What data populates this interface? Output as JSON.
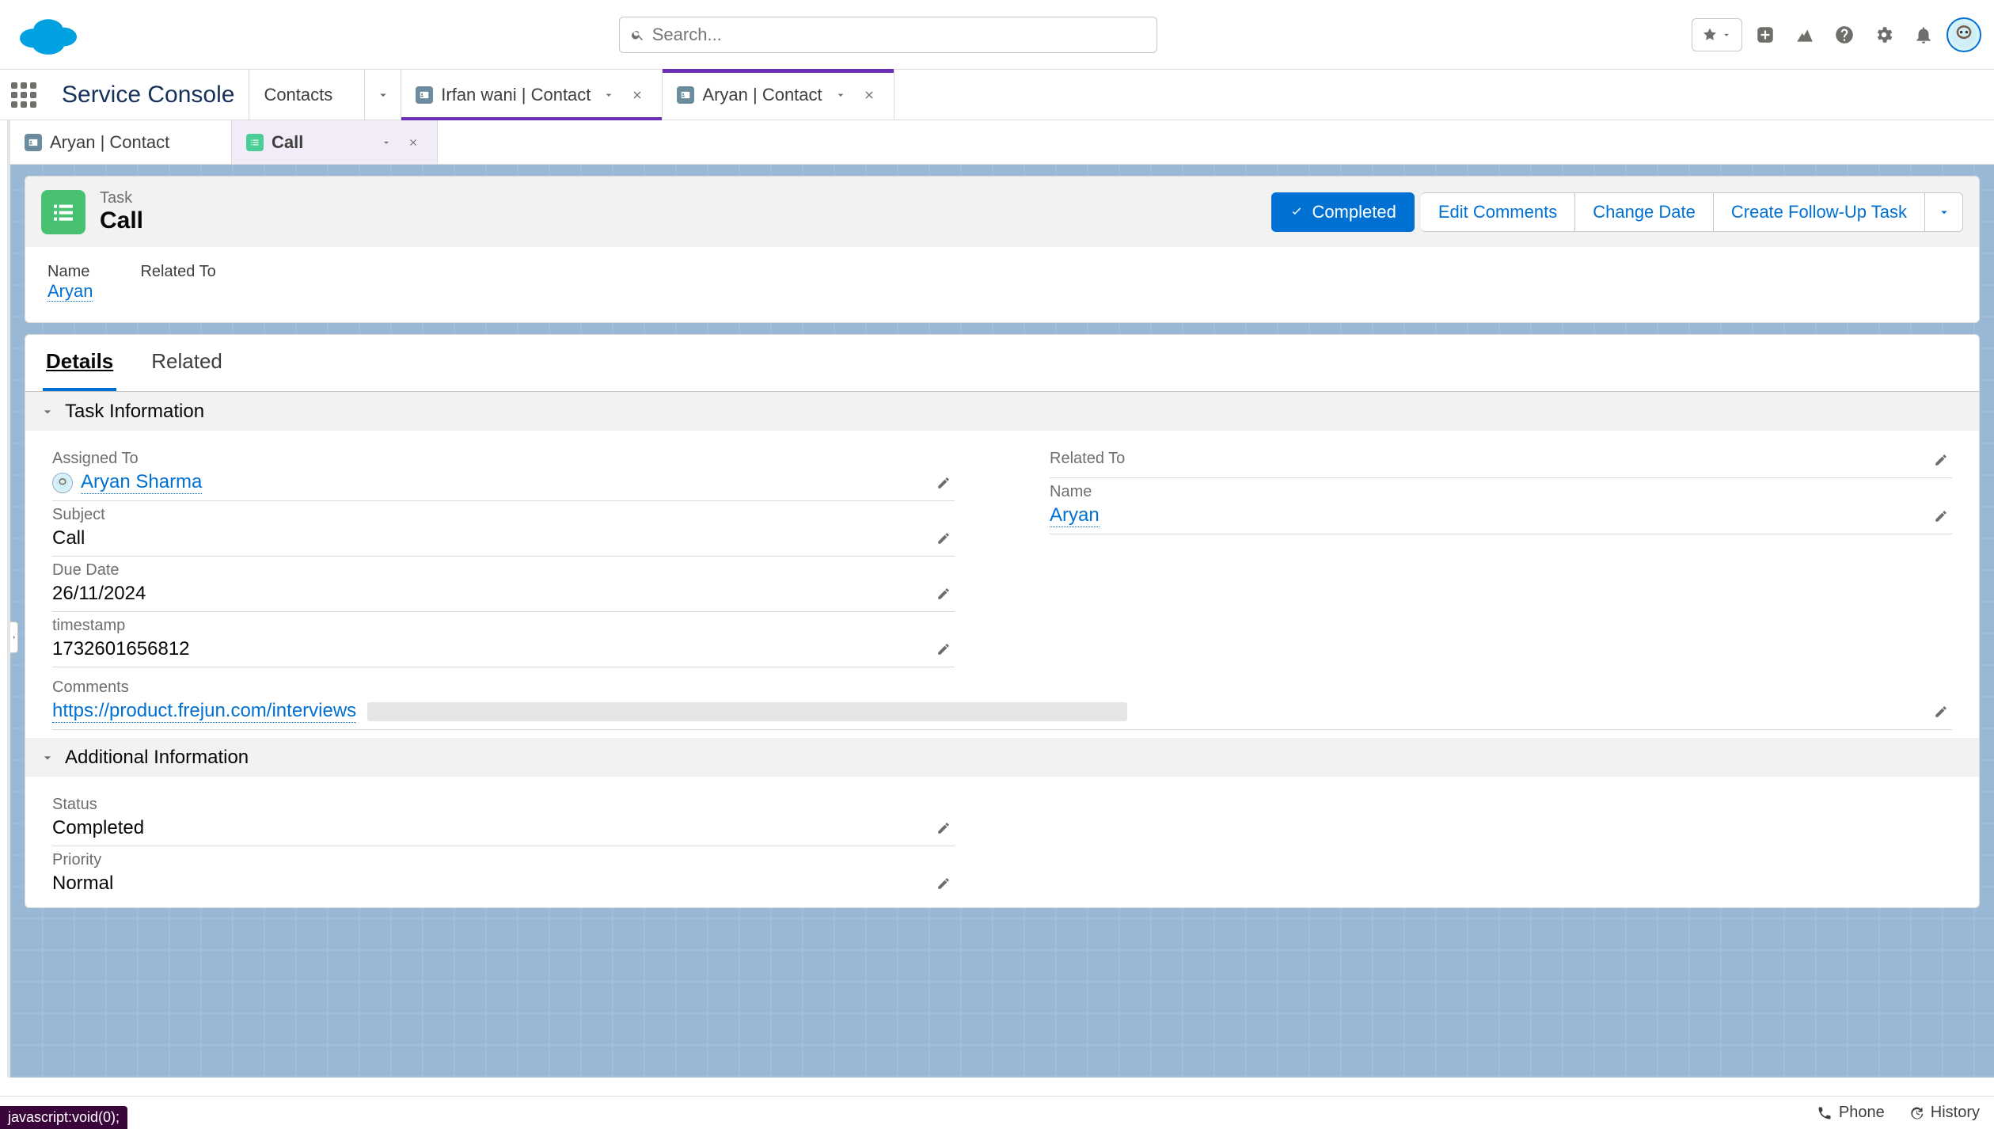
{
  "header": {
    "search_placeholder": "Search...",
    "app_name": "Service Console"
  },
  "workspace_tabs": {
    "nav_item": "Contacts",
    "tabs": [
      {
        "label": "Irfan wani | Contact"
      },
      {
        "label": "Aryan | Contact"
      }
    ]
  },
  "sub_tabs": [
    {
      "label": "Aryan | Contact",
      "icon": "contact"
    },
    {
      "label": "Call",
      "icon": "task",
      "active": true
    }
  ],
  "highlights": {
    "eyebrow": "Task",
    "title": "Call",
    "actions": {
      "completed": "Completed",
      "edit_comments": "Edit Comments",
      "change_date": "Change Date",
      "follow_up": "Create Follow-Up Task"
    },
    "compact": {
      "name_label": "Name",
      "name_value": "Aryan",
      "related_label": "Related To",
      "related_value": ""
    }
  },
  "detail_tabs": {
    "details": "Details",
    "related": "Related"
  },
  "sections": {
    "task_info": "Task Information",
    "additional_info": "Additional Information"
  },
  "fields": {
    "assigned_to": {
      "label": "Assigned To",
      "value": "Aryan Sharma"
    },
    "related_to": {
      "label": "Related To",
      "value": ""
    },
    "subject": {
      "label": "Subject",
      "value": "Call"
    },
    "name": {
      "label": "Name",
      "value": "Aryan"
    },
    "due_date": {
      "label": "Due Date",
      "value": "26/11/2024"
    },
    "timestamp": {
      "label": "timestamp",
      "value": "1732601656812"
    },
    "comments": {
      "label": "Comments",
      "value": "https://product.frejun.com/interviews"
    },
    "status": {
      "label": "Status",
      "value": "Completed"
    },
    "priority": {
      "label": "Priority",
      "value": "Normal"
    }
  },
  "utility": {
    "phone": "Phone",
    "history": "History"
  },
  "status_bar": "javascript:void(0);"
}
